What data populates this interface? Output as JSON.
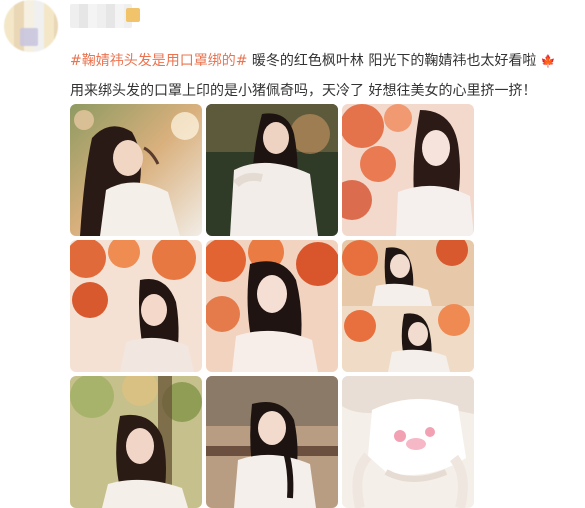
{
  "post": {
    "hashtag": "#鞠婧祎头发是用口罩绑的#",
    "line1_rest": " 暖冬的红色枫叶林 阳光下的鞠婧祎也太好看啦",
    "maple_icon": "maple-leaf-icon",
    "line2": "用来绑头发的口罩上印的是小猪佩奇吗，天冷了 好想往美女的心里挤一挤！"
  },
  "photos": [
    {
      "id": "photo-1",
      "desc": "girl with dark hair in white sweater, leaves"
    },
    {
      "id": "photo-2",
      "desc": "girl in white sweater, dark forest"
    },
    {
      "id": "photo-3",
      "desc": "girl behind red maple leaves"
    },
    {
      "id": "photo-4",
      "desc": "girl among orange leaves"
    },
    {
      "id": "photo-5",
      "desc": "girl in front of red leaves"
    },
    {
      "id": "photo-6",
      "desc": "two-shot collage with red leaves"
    },
    {
      "id": "photo-7",
      "desc": "girl with green trees"
    },
    {
      "id": "photo-8",
      "desc": "girl with braid on bench"
    },
    {
      "id": "photo-9",
      "desc": "white mask with pig print"
    }
  ],
  "colors": {
    "tag": "#eb7350",
    "text": "#333333"
  }
}
